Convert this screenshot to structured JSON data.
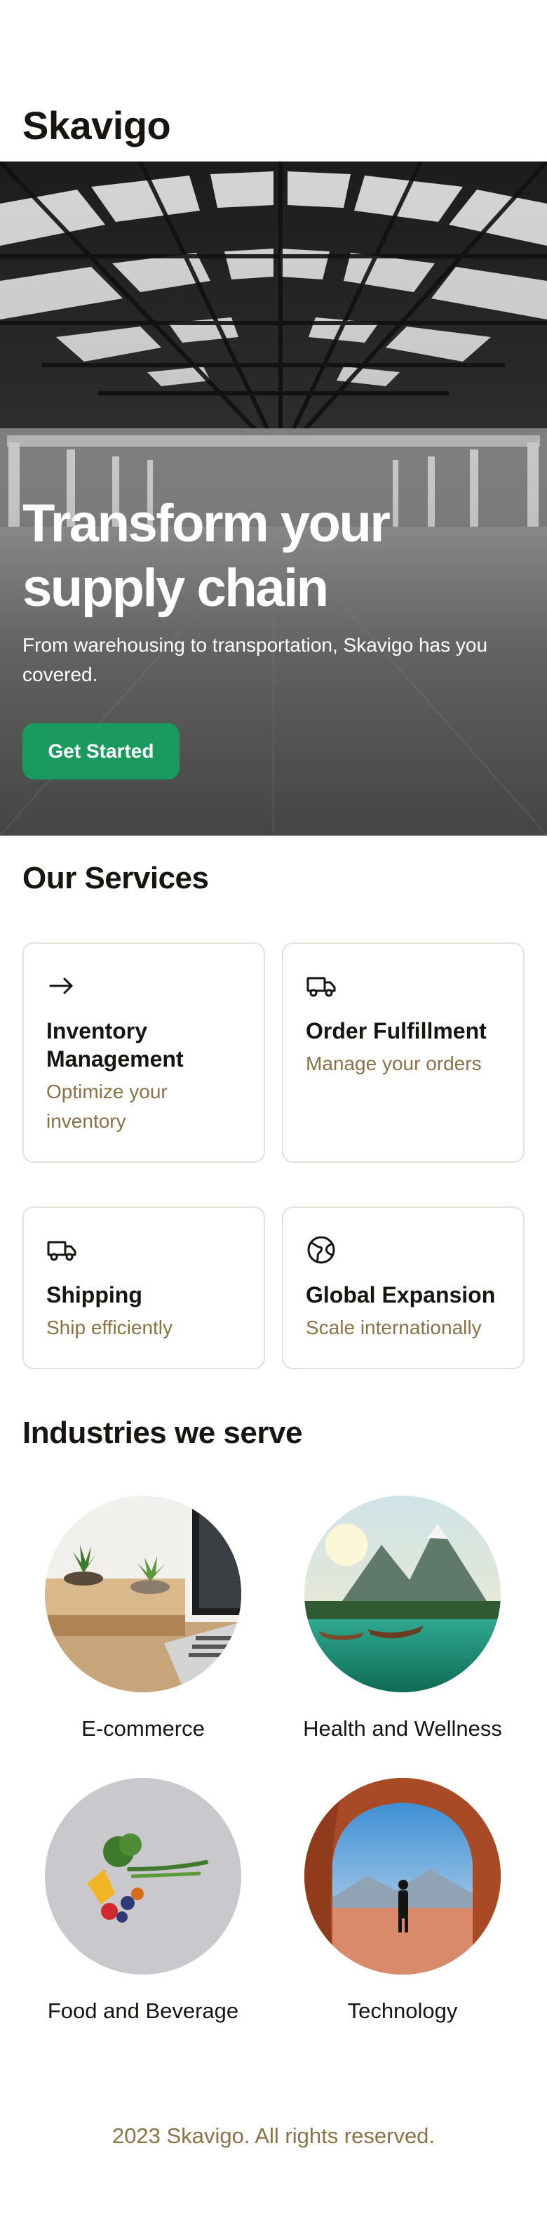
{
  "header": {
    "brand": "Skavigo"
  },
  "hero": {
    "title_line1": "Transform your",
    "title_line2": "supply chain",
    "subtitle": "From warehousing to transportation, Skavigo has you covered.",
    "cta_label": "Get Started"
  },
  "services": {
    "title": "Our Services",
    "items": [
      {
        "icon": "arrow-right-icon",
        "title": "Inventory Management",
        "desc": "Optimize your inventory"
      },
      {
        "icon": "truck-icon",
        "title": "Order Fulfillment",
        "desc": "Manage your orders"
      },
      {
        "icon": "truck-icon",
        "title": "Shipping",
        "desc": "Ship efficiently"
      },
      {
        "icon": "globe-icon",
        "title": "Global Expansion",
        "desc": "Scale internationally"
      }
    ]
  },
  "industries": {
    "title": "Industries we serve",
    "items": [
      {
        "label": "E-commerce"
      },
      {
        "label": "Health and Wellness"
      },
      {
        "label": "Food and Beverage"
      },
      {
        "label": "Technology"
      }
    ]
  },
  "footer": {
    "text": "2023 Skavigo. All rights reserved."
  },
  "colors": {
    "accent": "#1a9a5e",
    "muted_text": "#8a7246",
    "card_border": "#e6e1d8"
  }
}
